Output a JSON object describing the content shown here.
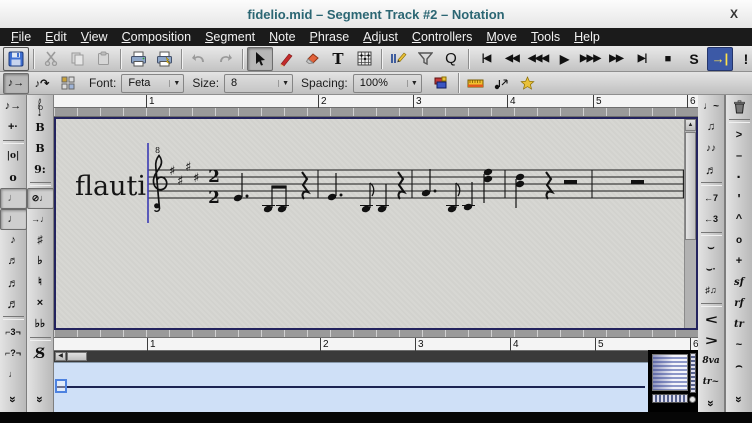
{
  "window": {
    "title": "fidelio.mid – Segment Track #2 – Notation",
    "close_label": "X"
  },
  "menubar": {
    "menus": [
      "File",
      "Edit",
      "View",
      "Composition",
      "Segment",
      "Note",
      "Phrase",
      "Adjust",
      "Controllers",
      "Move",
      "Tools",
      "Help"
    ]
  },
  "toolbar_main": {
    "text_tool": "T",
    "quantize": "Q",
    "transport": [
      {
        "name": "rewind-to-start",
        "glyph": "|◀"
      },
      {
        "name": "rewind",
        "glyph": "◀◀"
      },
      {
        "name": "rewind-fast",
        "glyph": "◀◀◀"
      },
      {
        "name": "play",
        "glyph": "▶"
      },
      {
        "name": "fast-forward-fast",
        "glyph": "▶▶▶"
      },
      {
        "name": "fast-forward",
        "glyph": "▶▶"
      },
      {
        "name": "forward-to-end",
        "glyph": "▶|"
      },
      {
        "name": "stop",
        "glyph": "■"
      },
      {
        "name": "solo",
        "glyph": "S"
      },
      {
        "name": "playback-to-pointer",
        "glyph": "→|"
      },
      {
        "name": "panic",
        "glyph": "!"
      }
    ]
  },
  "toolbar_format": {
    "font_label": "Font:",
    "font_value": "Feta",
    "size_label": "Size:",
    "size_value": "8",
    "spacing_label": "Spacing:",
    "spacing_value": "100%",
    "combo_arrow": "▼",
    "insert_mode_glyph": "♪→",
    "triplet_mode_glyph": "♪↷"
  },
  "rulers": {
    "top_measures": [
      "1",
      "2",
      "3",
      "4",
      "5",
      "6"
    ],
    "bottom_measures": [
      "1",
      "2",
      "3",
      "4",
      "5",
      "6"
    ]
  },
  "score": {
    "staff_label": "flauti",
    "clef": "treble octave-8 clef",
    "octave_mark": "8",
    "key_signature": "4 sharps (E major)",
    "sharp_glyph": "♯",
    "time_signature": {
      "numerator": "2",
      "denominator": "2"
    },
    "measures": [
      {
        "n": 1,
        "content": "dotted quarter, two beamed eighths below staff, quarter rest"
      },
      {
        "n": 2,
        "content": "dotted quarter, eighth, quarter, quarter rest"
      },
      {
        "n": 3,
        "content": "dotted quarter, eighth, quarter, two-note chord"
      },
      {
        "n": 4,
        "content": "two-note chord, quarter rest, half rest"
      },
      {
        "n": 5,
        "content": "half rest"
      }
    ]
  },
  "left_durations": {
    "items": [
      {
        "name": "note-rest-toggle",
        "glyph": "♪→"
      },
      {
        "name": "dot-toggle",
        "glyph": "+·"
      },
      {
        "name": "breve",
        "glyph": "|o|"
      },
      {
        "name": "whole-note",
        "glyph": "o"
      },
      {
        "name": "half-note",
        "glyph": "♩"
      },
      {
        "name": "quarter-note",
        "glyph": "♩"
      },
      {
        "name": "eighth-note",
        "glyph": "♪"
      },
      {
        "name": "sixteenth-note",
        "glyph": "♬"
      },
      {
        "name": "thirty-second-note",
        "glyph": "♬"
      },
      {
        "name": "sixty-fourth-note",
        "glyph": "♬"
      },
      {
        "name": "triplet",
        "glyph": "⌐3¬"
      },
      {
        "name": "tuplet",
        "glyph": "⌐?¬"
      },
      {
        "name": "grace-note",
        "glyph": "♩"
      },
      {
        "name": "more",
        "glyph": "»"
      }
    ]
  },
  "left_clefs": {
    "items": [
      {
        "name": "treble-clef"
      },
      {
        "name": "alto-clef",
        "glyph": "B"
      },
      {
        "name": "tenor-clef",
        "glyph": "B"
      },
      {
        "name": "bass-clef",
        "glyph": "9:"
      },
      {
        "name": "no-accidental",
        "glyph": "⊘♩"
      },
      {
        "name": "follow-accidental",
        "glyph": "→♩"
      },
      {
        "name": "sharp",
        "glyph": "♯"
      },
      {
        "name": "flat",
        "glyph": "♭"
      },
      {
        "name": "natural",
        "glyph": "♮"
      },
      {
        "name": "double-sharp",
        "glyph": "×"
      },
      {
        "name": "double-flat",
        "glyph": "♭♭"
      },
      {
        "name": "segno",
        "glyph": "S̸"
      },
      {
        "name": "more",
        "glyph": "»"
      }
    ]
  },
  "right_group": {
    "items": [
      {
        "name": "tie",
        "glyph": "♩~"
      },
      {
        "name": "beam",
        "glyph": "♫"
      },
      {
        "name": "unbeam",
        "glyph": "♪♪"
      },
      {
        "name": "auto-beam",
        "glyph": "♬"
      },
      {
        "name": "septuplet-insert",
        "glyph": "←7"
      },
      {
        "name": "triplet-insert",
        "glyph": "←3"
      },
      {
        "name": "slur",
        "glyph": "⌣"
      },
      {
        "name": "phrasing-slur",
        "glyph": "⌣·"
      },
      {
        "name": "grace-group",
        "glyph": "♯♫"
      },
      {
        "name": "crescendo",
        "glyph": "<"
      },
      {
        "name": "decrescendo",
        "glyph": ">"
      },
      {
        "name": "ottava-up",
        "glyph": "8va"
      },
      {
        "name": "trill-line",
        "glyph": "tr~"
      },
      {
        "name": "more",
        "glyph": "»"
      }
    ]
  },
  "right_marks": {
    "items": [
      {
        "name": "erase"
      },
      {
        "name": "accent",
        "glyph": ">"
      },
      {
        "name": "tenuto",
        "glyph": "–"
      },
      {
        "name": "staccato",
        "glyph": "·"
      },
      {
        "name": "staccatissimo",
        "glyph": "'"
      },
      {
        "name": "marcato",
        "glyph": "^"
      },
      {
        "name": "harmonic",
        "glyph": "o"
      },
      {
        "name": "lv",
        "glyph": "+"
      },
      {
        "name": "sforzando",
        "glyph": "sf"
      },
      {
        "name": "rinforzando",
        "glyph": "rf"
      },
      {
        "name": "trill",
        "glyph": "tr"
      },
      {
        "name": "turn",
        "glyph": "~"
      },
      {
        "name": "pause",
        "glyph": "⌢"
      },
      {
        "name": "more",
        "glyph": "»"
      }
    ]
  },
  "scrollbars": {
    "up": "▲",
    "left": "◀",
    "right": "▶"
  },
  "colors": {
    "accent_blue": "#3c59a6",
    "panner_bg": "#cfe0f7",
    "canvas_bg": "#d7d7d3",
    "canvas_border": "#23235e",
    "title_text": "#2b6673",
    "menubar_bg": "#1b1b1b"
  }
}
